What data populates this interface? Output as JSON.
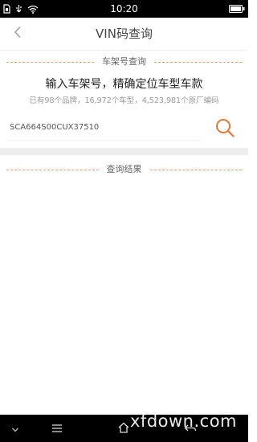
{
  "status_bar": {
    "time": "10:20",
    "icons": [
      "sim-icon",
      "usb-icon",
      "wifi-icon",
      "battery-icon"
    ]
  },
  "header": {
    "title": "VIN码查询",
    "back_icon": "chevron-left-icon"
  },
  "vin_section": {
    "label": "车架号查询",
    "heading": "输入车架号，精确定位车型车款",
    "subtext": "已有98个品牌，16,972个车型，4,523,981个原厂编码",
    "input_value": "SCA664S00CUX37510",
    "search_icon": "search-icon"
  },
  "results_section": {
    "label": "查询结果"
  },
  "nav_bar": {
    "icons": [
      "chevron-down-icon",
      "menu-icon",
      "home-icon",
      "back-icon"
    ]
  },
  "watermark": {
    "text": "xfdown.com"
  },
  "colors": {
    "accent": "#e07a3a",
    "divider": "#e3a47a",
    "background": "#ffffff",
    "band": "#eeeeee"
  }
}
